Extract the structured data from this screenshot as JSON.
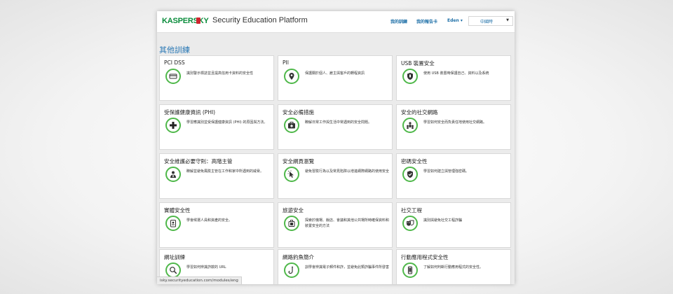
{
  "header": {
    "logo_text": "KASPERSKY",
    "platform_title": "Security Education Platform",
    "nav": {
      "my_training": "我的訓練",
      "my_report_card": "我的報告卡",
      "user_menu": "Eden ▾"
    },
    "language": {
      "selected": "中國時"
    }
  },
  "main": {
    "section_title": "其他訓練",
    "cards": [
      {
        "title": "PCI DSS",
        "desc": "識別警示標誌並且提高信用卡資料的安全性",
        "icon": "credit-card-icon"
      },
      {
        "title": "PII",
        "desc": "保護關於個人、雇主與客戶的轉程資訊",
        "icon": "location-pin-icon"
      },
      {
        "title": "USB 裝置安全",
        "desc": "使用 USB 裝置時保護自己、資料以及系統",
        "icon": "usb-shield-icon"
      },
      {
        "title": "受保護健康資訊 (PHI)",
        "desc": "學習應識別並受保護健康資訊 (PHI) 的原因與方法。",
        "icon": "medical-cross-icon"
      },
      {
        "title": "安全必備措施",
        "desc": "瞭解日常工作與生活中常遇到的安全問題。",
        "icon": "first-aid-kit-icon"
      },
      {
        "title": "安全的社交網路",
        "desc": "學習如何安全而負責任地使用社交網路。",
        "icon": "social-network-icon"
      },
      {
        "title": "安全維護必要守則：高階主管",
        "desc": "瞭解並避免風險主管在工作和家中所遇到的威脅。",
        "icon": "executive-icon"
      },
      {
        "title": "安全網頁瀏覽",
        "desc": "避免冒險行為以及常見陷阱以增進網際網路的使用安全",
        "icon": "cursor-click-icon"
      },
      {
        "title": "密碼安全性",
        "desc": "學習如何建立與管理強密碼。",
        "icon": "password-shield-icon"
      },
      {
        "title": "實體安全性",
        "desc": "學會候選人員和資產的安全。",
        "icon": "id-badge-icon"
      },
      {
        "title": "旅遊安全",
        "desc": "探索於機場、飯店、會議和其他公共場所時確保資料和裝置安全的方法",
        "icon": "travel-icon"
      },
      {
        "title": "社交工程",
        "desc": "識別與避免社交工程詐騙",
        "icon": "masks-icon"
      },
      {
        "title": "網址訓練",
        "desc": "學習如何辨識詐欺的 URL",
        "icon": "url-magnifier-icon"
      },
      {
        "title": "網路釣魚簡介",
        "desc": "訓學會辨識電子郵件和詐，並避免此類詐騙事件所發害",
        "icon": "phishing-hook-icon"
      },
      {
        "title": "行動應用程式安全性",
        "desc": "了解如何判斷行動應用程式的安全性。",
        "icon": "mobile-app-icon"
      }
    ]
  },
  "statusbar": {
    "url": "isky.securityeducation.com/modules/eng"
  },
  "colors": {
    "accent_green": "#4fb84a",
    "brand_green": "#0a8c3b",
    "link_blue": "#1d6fa7",
    "heading_blue": "#2a78b5"
  }
}
